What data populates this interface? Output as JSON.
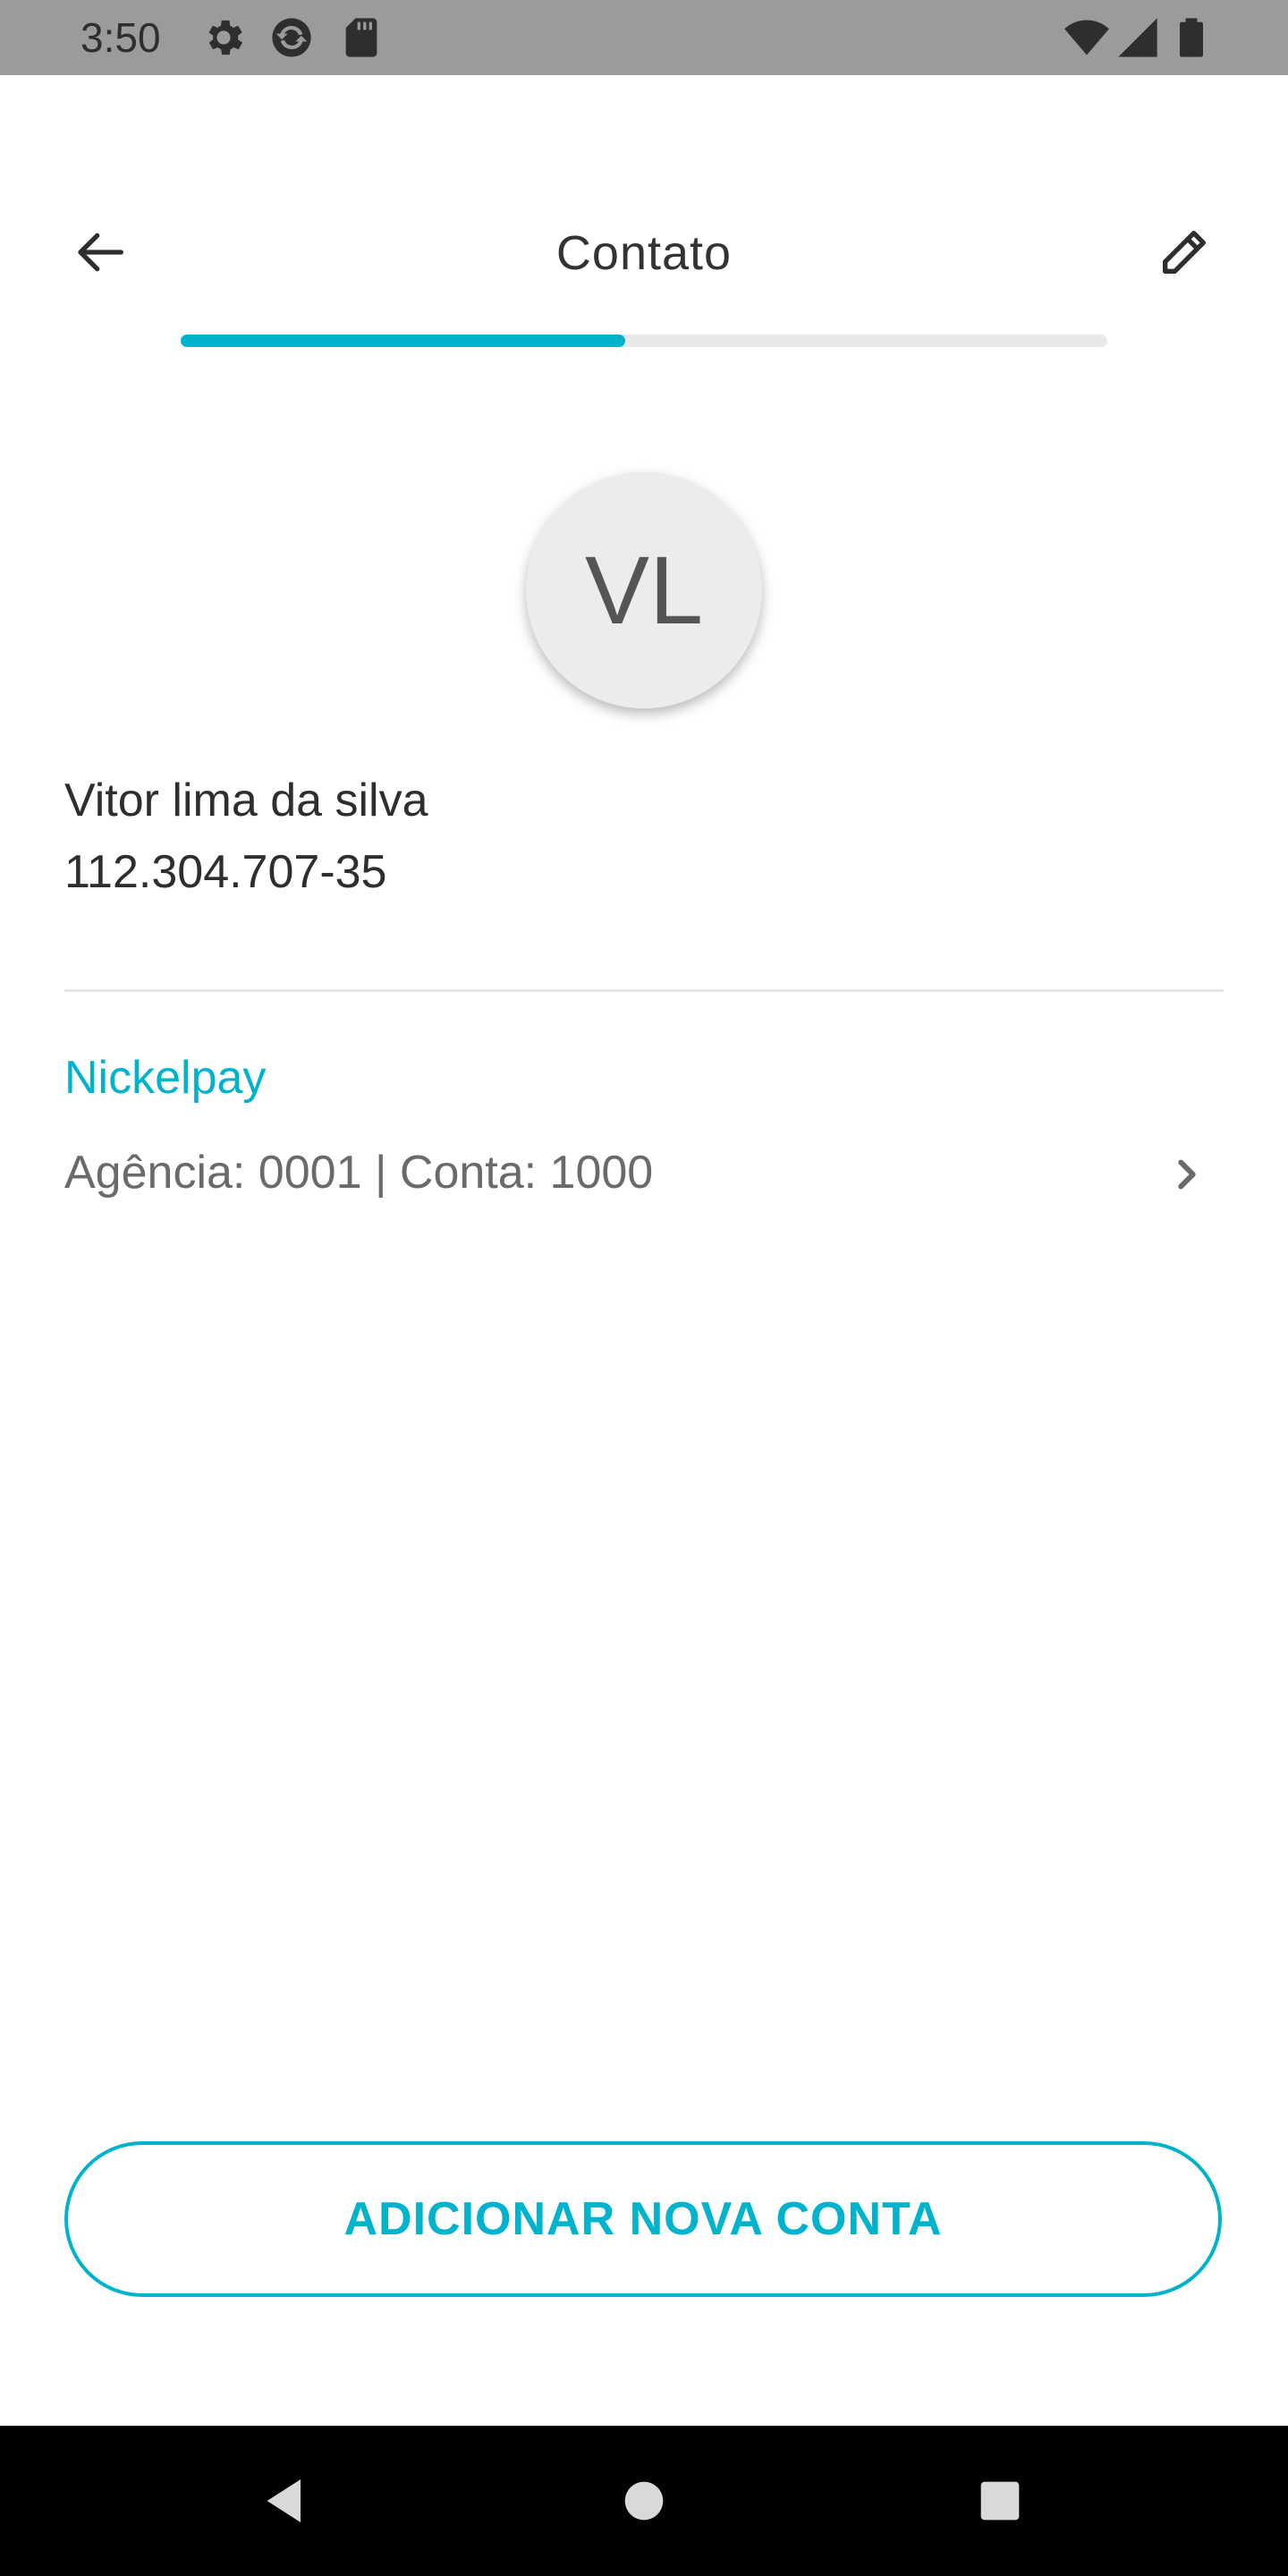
{
  "status_bar": {
    "time": "3:50",
    "left_icons": [
      "settings-icon",
      "sync-icon",
      "sd-card-icon"
    ],
    "right_icons": [
      "wifi-icon",
      "cell-signal-icon",
      "battery-icon"
    ]
  },
  "header": {
    "title": "Contato",
    "back_icon": "arrow-left-icon",
    "edit_icon": "pencil-icon"
  },
  "progress": {
    "fraction": 0.48
  },
  "contact": {
    "initials": "VL",
    "name": "Vitor lima da silva",
    "document": "112.304.707-35"
  },
  "account": {
    "bank_name": "Nickelpay",
    "details": "Agência: 0001 | Conta: 1000"
  },
  "actions": {
    "add_account_label": "ADICIONAR NOVA CONTA"
  },
  "nav_bar": {
    "buttons": [
      "back-triangle-icon",
      "home-circle-icon",
      "recents-square-icon"
    ]
  },
  "colors": {
    "accent": "#00b3cc",
    "status_bar": "#9b9b9b",
    "text_primary": "#2e2e2e",
    "text_secondary": "#6a6a6a",
    "progress_track": "#e8e8e8",
    "nav_bar": "#000000"
  }
}
